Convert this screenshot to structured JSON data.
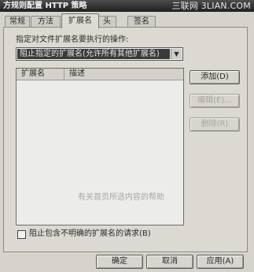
{
  "window": {
    "title": "方规则配置 HTTP 策略",
    "watermark": "三联网 3LIAN.COM"
  },
  "tabs": [
    {
      "label": "常规",
      "active": false
    },
    {
      "label": "方法",
      "active": false
    },
    {
      "label": "扩展名",
      "active": true
    },
    {
      "label": "头",
      "active": false
    },
    {
      "label": "签名",
      "active": false
    }
  ],
  "extensions_tab": {
    "instruction": "指定对文件扩展名要执行的操作:",
    "action_select": {
      "value": "阻止指定的扩展名(允许所有其他扩展名)"
    },
    "list": {
      "columns": [
        "扩展名",
        "描述"
      ],
      "rows": [],
      "ghost_text": "有关首页所选内容的帮助"
    },
    "buttons": {
      "add": "添加(D)",
      "edit": "编辑(E)...",
      "delete": "删除(R)"
    },
    "block_ambiguous": {
      "label": "阻止包含不明确的扩展名的请求(B)",
      "checked": false
    }
  },
  "footer": {
    "ok": "确定",
    "cancel": "取消",
    "apply": "应用(A)"
  }
}
